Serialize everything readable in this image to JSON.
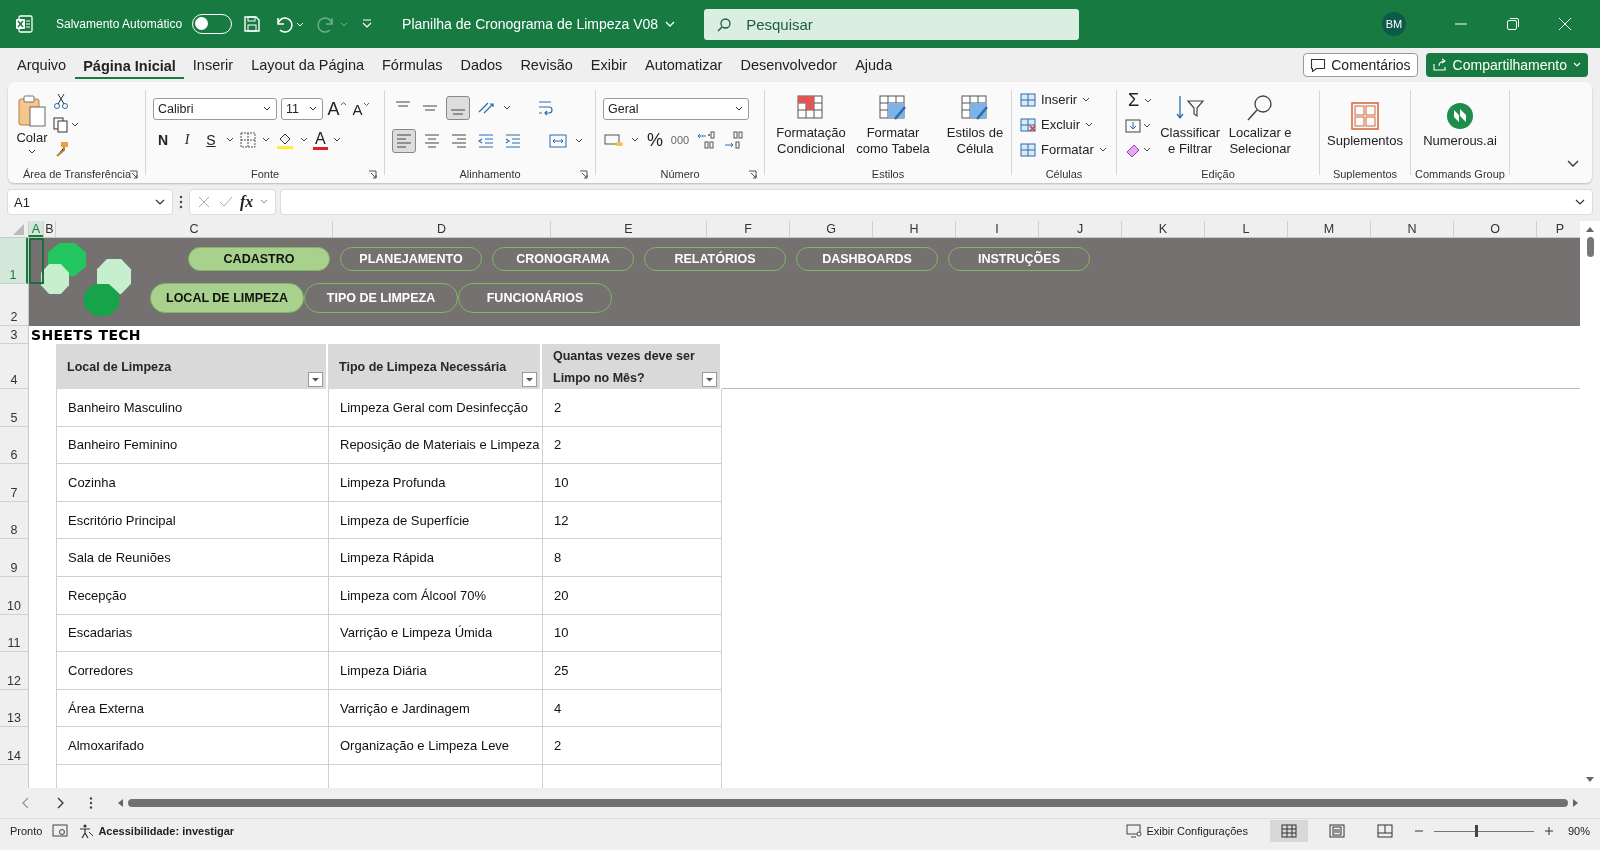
{
  "title_bar": {
    "autosave_label": "Salvamento Automático",
    "autosave_on": false,
    "document_title": "Planilha de Cronograma de Limpeza V08",
    "search_placeholder": "Pesquisar",
    "user_initials": "BM"
  },
  "menu_tabs": [
    {
      "label": "Arquivo",
      "selected": false
    },
    {
      "label": "Página Inicial",
      "selected": true
    },
    {
      "label": "Inserir",
      "selected": false
    },
    {
      "label": "Layout da Página",
      "selected": false
    },
    {
      "label": "Fórmulas",
      "selected": false
    },
    {
      "label": "Dados",
      "selected": false
    },
    {
      "label": "Revisão",
      "selected": false
    },
    {
      "label": "Exibir",
      "selected": false
    },
    {
      "label": "Automatizar",
      "selected": false
    },
    {
      "label": "Desenvolvedor",
      "selected": false
    },
    {
      "label": "Ajuda",
      "selected": false
    }
  ],
  "comments_button": "Comentários",
  "share_button": "Compartilhamento",
  "ribbon": {
    "clipboard": {
      "paste": "Colar",
      "group": "Área de Transferência"
    },
    "font": {
      "name": "Calibri",
      "size": "11",
      "grow": "A",
      "shrink": "A",
      "bold": "N",
      "italic": "I",
      "underline": "S",
      "color_letter": "A",
      "group": "Fonte"
    },
    "alignment": {
      "group": "Alinhamento"
    },
    "number": {
      "format": "Geral",
      "percent": "%",
      "thousands": "000",
      "group": "Número"
    },
    "styles": {
      "items": [
        "Formatação Condicional",
        "Formatar como Tabela",
        "Estilos de Célula"
      ],
      "group": "Estilos"
    },
    "cells": {
      "items": [
        "Inserir",
        "Excluir",
        "Formatar"
      ],
      "group": "Células"
    },
    "editing": {
      "sum": "Σ",
      "items": [
        "Classificar e Filtrar",
        "Localizar e Selecionar"
      ],
      "group": "Edição"
    },
    "addins": {
      "label": "Suplementos",
      "group": "Suplementos"
    },
    "commands": {
      "label": "Numerous.ai",
      "group": "Commands Group"
    }
  },
  "formula_bar": {
    "name_box": "A1",
    "function_label": "fx"
  },
  "column_headers": [
    {
      "label": "A",
      "selected": true
    },
    {
      "label": "B",
      "selected": false
    },
    {
      "label": "C",
      "selected": false
    },
    {
      "label": "D",
      "selected": false
    },
    {
      "label": "E",
      "selected": false
    },
    {
      "label": "F",
      "selected": false
    },
    {
      "label": "G",
      "selected": false
    },
    {
      "label": "H",
      "selected": false
    },
    {
      "label": "I",
      "selected": false
    },
    {
      "label": "J",
      "selected": false
    },
    {
      "label": "K",
      "selected": false
    },
    {
      "label": "L",
      "selected": false
    },
    {
      "label": "M",
      "selected": false
    },
    {
      "label": "N",
      "selected": false
    },
    {
      "label": "O",
      "selected": false
    },
    {
      "label": "P",
      "selected": false
    }
  ],
  "row_headers": [
    {
      "label": "1",
      "selected": true
    },
    {
      "label": "2",
      "selected": false
    },
    {
      "label": "3",
      "selected": false
    },
    {
      "label": "4",
      "selected": false
    },
    {
      "label": "5",
      "selected": false
    },
    {
      "label": "6",
      "selected": false
    },
    {
      "label": "7",
      "selected": false
    },
    {
      "label": "8",
      "selected": false
    },
    {
      "label": "9",
      "selected": false
    },
    {
      "label": "10",
      "selected": false
    },
    {
      "label": "11",
      "selected": false
    },
    {
      "label": "12",
      "selected": false
    },
    {
      "label": "13",
      "selected": false
    },
    {
      "label": "14",
      "selected": false
    }
  ],
  "nav_primary": [
    {
      "label": "CADASTRO",
      "selected": true
    },
    {
      "label": "PLANEJAMENTO",
      "selected": false
    },
    {
      "label": "CRONOGRAMA",
      "selected": false
    },
    {
      "label": "RELATÓRIOS",
      "selected": false
    },
    {
      "label": "DASHBOARDS",
      "selected": false
    },
    {
      "label": "INSTRUÇÕES",
      "selected": false
    }
  ],
  "nav_secondary": [
    {
      "label": "LOCAL DE LIMPEZA",
      "selected": true
    },
    {
      "label": "TIPO DE LIMPEZA",
      "selected": false
    },
    {
      "label": "FUNCIONÁRIOS",
      "selected": false
    }
  ],
  "brand": "SHEETS TECH",
  "table": {
    "columns": [
      "Local de Limpeza",
      "Tipo de Limpeza Necessária",
      "Quantas vezes deve ser Limpo no Mês?"
    ],
    "rows": [
      [
        "Banheiro Masculino",
        "Limpeza Geral com Desinfecção",
        "2"
      ],
      [
        "Banheiro Feminino",
        "Reposição de Materiais e Limpeza",
        "2"
      ],
      [
        "Cozinha",
        "Limpeza Profunda",
        "10"
      ],
      [
        "Escritório Principal",
        "Limpeza de Superfície",
        "12"
      ],
      [
        "Sala de Reuniões",
        "Limpeza Rápida",
        "8"
      ],
      [
        "Recepção",
        "Limpeza com Álcool 70%",
        "20"
      ],
      [
        "Escadarias",
        "Varrição e Limpeza Úmida",
        "10"
      ],
      [
        "Corredores",
        "Limpeza Diária",
        "25"
      ],
      [
        "Área Externa",
        "Varrição e Jardinagem",
        "4"
      ],
      [
        "Almoxarifado",
        "Organização e Limpeza Leve",
        "2"
      ]
    ]
  },
  "status_bar": {
    "ready": "Pronto",
    "accessibility": "Acessibilidade: investigar",
    "display_settings": "Exibir Configurações",
    "views": [
      {
        "kind": "normal",
        "selected": true
      },
      {
        "kind": "page_layout",
        "selected": false
      },
      {
        "kind": "page_break",
        "selected": false
      }
    ],
    "zoom": {
      "level": 0.42,
      "reading": "90%"
    }
  }
}
